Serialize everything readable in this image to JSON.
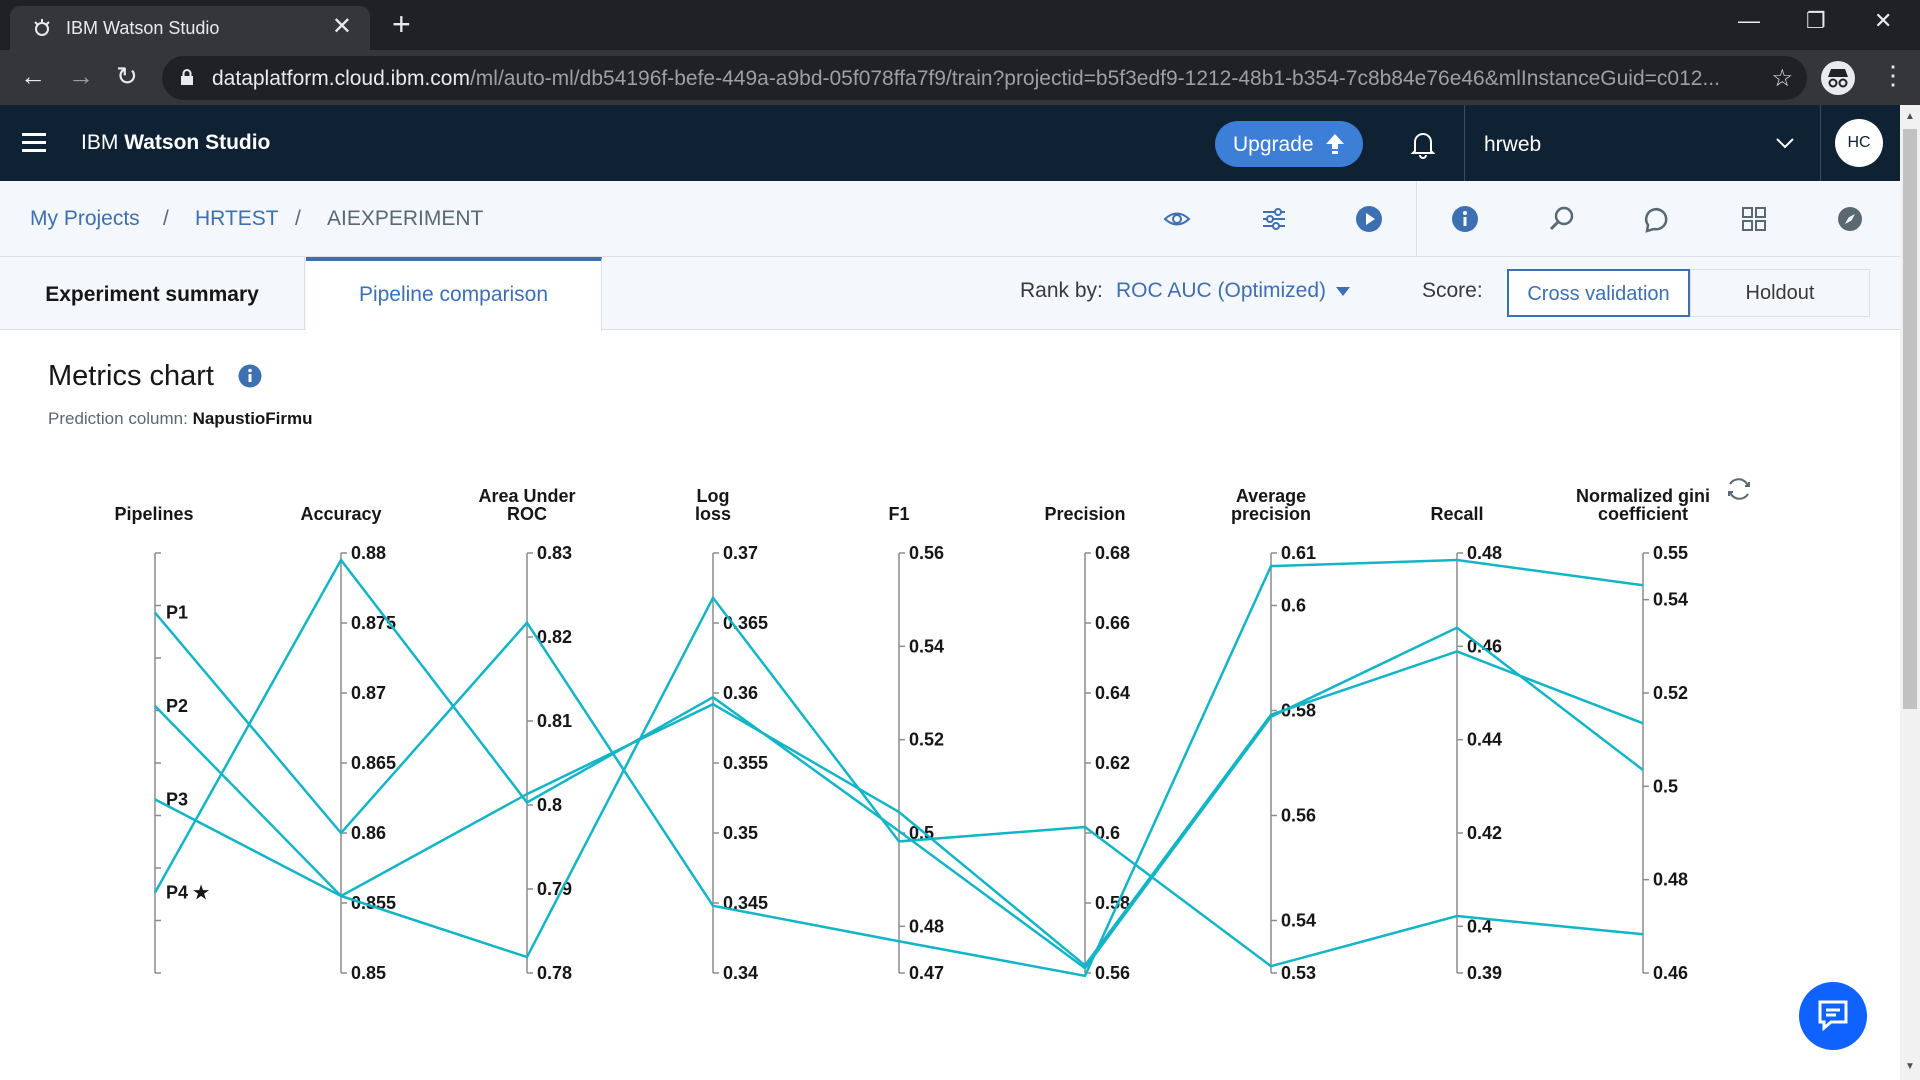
{
  "browser": {
    "tab_title": "IBM Watson Studio",
    "url_domain": "dataplatform.cloud.ibm.com",
    "url_path": "/ml/auto-ml/db54196f-befe-449a-a9bd-05f078ffa7f9/train?projectid=b5f3edf9-1212-48b1-b354-7c8b84e76e46&mlInstanceGuid=c012..."
  },
  "header": {
    "brand_prefix": "IBM",
    "brand_name": "Watson Studio",
    "upgrade_label": "Upgrade",
    "account_name": "hrweb",
    "avatar_initials": "HC"
  },
  "breadcrumb": {
    "items": [
      "My Projects",
      "HRTEST",
      "AIEXPERIMENT"
    ],
    "separator": "/"
  },
  "tabs": {
    "summary_label": "Experiment summary",
    "comparison_label": "Pipeline comparison"
  },
  "ranking": {
    "rank_by_label": "Rank by:",
    "rank_by_value": "ROC AUC (Optimized)",
    "score_label": "Score:",
    "score_options": [
      "Cross validation",
      "Holdout"
    ],
    "score_selected": "Cross validation"
  },
  "metrics": {
    "title": "Metrics chart",
    "prediction_label": "Prediction column:",
    "prediction_value": "NapustioFirmu"
  },
  "colors": {
    "line": "#12b5c6",
    "header_bg": "#0e2233",
    "accent": "#3d70b2"
  },
  "chart_data": {
    "type": "parallel_coordinates",
    "pipeline_axis": {
      "title": [
        "Pipelines"
      ],
      "labels": [
        "P1",
        "P2",
        "P3",
        "P4 ★"
      ]
    },
    "axes": [
      {
        "title": [
          "Accuracy"
        ],
        "min": 0.85,
        "max": 0.88,
        "ticks": [
          "0.88",
          "0.875",
          "0.87",
          "0.865",
          "0.86",
          "0.855",
          "0.85"
        ]
      },
      {
        "title": [
          "Area Under",
          "ROC"
        ],
        "min": 0.78,
        "max": 0.83,
        "ticks": [
          "0.83",
          "0.82",
          "0.81",
          "0.8",
          "0.79",
          "0.78"
        ]
      },
      {
        "title": [
          "Log",
          "loss"
        ],
        "min": 0.34,
        "max": 0.37,
        "ticks": [
          "0.37",
          "0.365",
          "0.36",
          "0.355",
          "0.35",
          "0.345",
          "0.34"
        ]
      },
      {
        "title": [
          "F1"
        ],
        "min": 0.47,
        "max": 0.56,
        "ticks": [
          "0.56",
          "0.54",
          "0.52",
          "0.5",
          "0.48",
          "0.47"
        ]
      },
      {
        "title": [
          "Precision"
        ],
        "min": 0.56,
        "max": 0.68,
        "ticks": [
          "0.68",
          "0.66",
          "0.64",
          "0.62",
          "0.6",
          "0.58",
          "0.56"
        ]
      },
      {
        "title": [
          "Average",
          "precision"
        ],
        "min": 0.53,
        "max": 0.61,
        "ticks": [
          "0.61",
          "0.6",
          "0.58",
          "0.56",
          "0.54",
          "0.53"
        ]
      },
      {
        "title": [
          "Recall"
        ],
        "min": 0.39,
        "max": 0.48,
        "ticks": [
          "0.48",
          "0.46",
          "0.44",
          "0.42",
          "0.4",
          "0.39"
        ]
      },
      {
        "title": [
          "Normalized gini",
          "coefficient"
        ],
        "min": 0.46,
        "max": 0.55,
        "ticks": [
          "0.55",
          "0.54",
          "0.52",
          "0.5",
          "0.48",
          "0.46"
        ]
      }
    ],
    "series": [
      {
        "name": "P1",
        "values": [
          0.86,
          0.8217,
          0.3448,
          0.4768,
          0.5592,
          0.6075,
          0.4785,
          0.5431
        ]
      },
      {
        "name": "P2",
        "values": [
          0.8555,
          0.7819,
          0.3668,
          0.4982,
          0.6017,
          0.5313,
          0.4022,
          0.4683
        ]
      },
      {
        "name": "P3",
        "values": [
          0.8555,
          0.8013,
          0.3592,
          0.5045,
          0.5622,
          0.5792,
          0.4589,
          0.5135
        ]
      },
      {
        "name": "P4 ★",
        "values": [
          0.8795,
          0.8003,
          0.3597,
          0.5004,
          0.5614,
          0.5788,
          0.464,
          0.5035
        ]
      }
    ]
  }
}
